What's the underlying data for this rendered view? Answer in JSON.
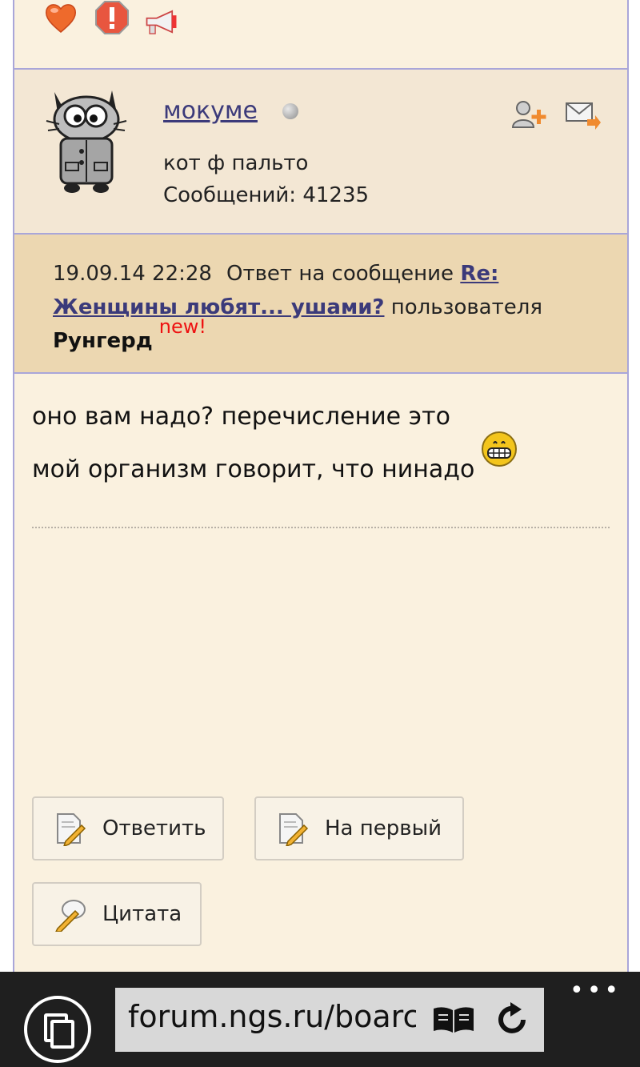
{
  "user": {
    "name": "мокуме",
    "title": "кот ф пальто",
    "posts_label": "Сообщений:",
    "posts_count": "41235"
  },
  "reply": {
    "date": "19.09.14 22:28",
    "prefix": "Ответ на сообщение",
    "subject": "Re: Женщины любят... ушами?",
    "by": "пользователя",
    "author": "Рунгерд",
    "new_badge": "new!"
  },
  "post": {
    "line1": "оно вам надо? перечисление это",
    "line2": "мой организм говорит, что нинадо"
  },
  "buttons": {
    "reply": "Ответить",
    "first": "На первый",
    "quote": "Цитата"
  },
  "browser": {
    "url": "forum.ngs.ru/boarc",
    "more": "•••"
  },
  "colors": {
    "page_bg": "#faf1df",
    "user_bg": "#f3e7d4",
    "reply_bg": "#ecd7b1",
    "link": "#3b3a7a",
    "new_badge": "#ee1111",
    "frame_border": "#a9a6d9",
    "browser_bar": "#1f1f1f"
  },
  "icons": [
    "heart-icon",
    "alert-icon",
    "megaphone-icon",
    "add-friend-icon",
    "private-message-icon",
    "smile-icon",
    "edit-document-icon",
    "quote-icon",
    "tabs-icon",
    "reading-view-icon",
    "refresh-icon"
  ]
}
